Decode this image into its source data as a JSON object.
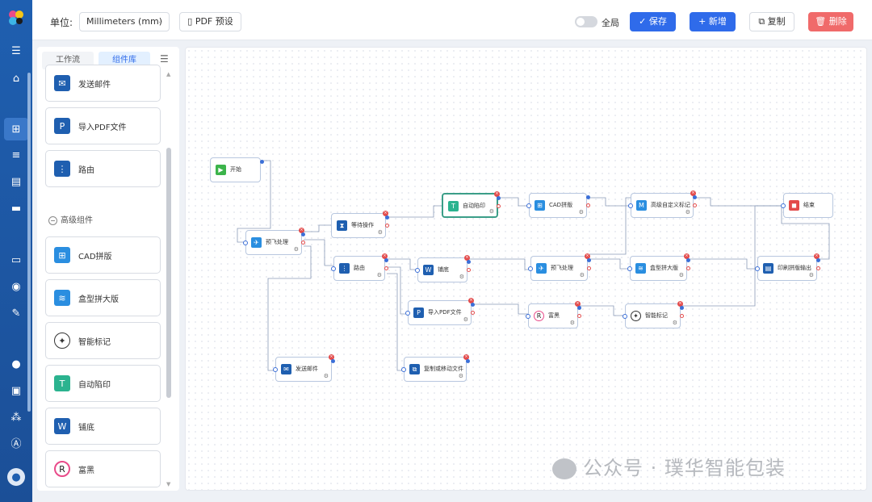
{
  "topbar": {
    "unit_label": "单位:",
    "unit_value": "Millimeters (mm)",
    "pdf_preset": "PDF 预设",
    "global_label": "全局",
    "save": "保存",
    "add": "新增",
    "copy": "复制",
    "delete": "删除"
  },
  "panel": {
    "tabs": [
      "工作流",
      "组件库"
    ],
    "section_advanced": "高级组件",
    "components": [
      {
        "label": "发送邮件",
        "icon": "mail-icon",
        "color": "#1f5fb0"
      },
      {
        "label": "导入PDF文件",
        "icon": "pdf-icon",
        "color": "#1f5fb0"
      },
      {
        "label": "路由",
        "icon": "router-icon",
        "color": "#1f5fb0"
      },
      {
        "label": "CAD拼版",
        "icon": "cad-icon",
        "color": "#2a8ee0"
      },
      {
        "label": "盒型拼大版",
        "icon": "box-layout-icon",
        "color": "#2a8ee0"
      },
      {
        "label": "智能标记",
        "icon": "smart-mark-icon",
        "color": "#333333"
      },
      {
        "label": "自动陷印",
        "icon": "trap-icon",
        "color": "#2bb38f"
      },
      {
        "label": "铺底",
        "icon": "underlay-icon",
        "color": "#1f5fb0"
      },
      {
        "label": "富黑",
        "icon": "rich-black-icon",
        "color": "#222222"
      }
    ]
  },
  "nodes": [
    {
      "id": "start",
      "label": "开始",
      "icon": "play-icon",
      "color": "#3cb44b"
    },
    {
      "id": "preflight1",
      "label": "预飞处理",
      "icon": "plane-icon",
      "color": "#2a8ee0"
    },
    {
      "id": "wait",
      "label": "等待操作",
      "icon": "hourglass-icon",
      "color": "#1f5fb0"
    },
    {
      "id": "autotrap",
      "label": "自动陷印",
      "icon": "trap-icon",
      "color": "#2bb38f"
    },
    {
      "id": "cad",
      "label": "CAD拼版",
      "icon": "cad-icon",
      "color": "#2a8ee0"
    },
    {
      "id": "custommark",
      "label": "高级自定义标记",
      "icon": "mark-icon",
      "color": "#2a8ee0"
    },
    {
      "id": "end",
      "label": "结束",
      "icon": "stop-icon",
      "color": "#e34b4b"
    },
    {
      "id": "route",
      "label": "路由",
      "icon": "router-icon",
      "color": "#1f5fb0"
    },
    {
      "id": "underlay",
      "label": "铺底",
      "icon": "underlay-icon",
      "color": "#1f5fb0"
    },
    {
      "id": "preflight2",
      "label": "预飞处理",
      "icon": "plane-icon",
      "color": "#2a8ee0"
    },
    {
      "id": "boxlayout",
      "label": "盒型拼大版",
      "icon": "box-layout-icon",
      "color": "#2a8ee0"
    },
    {
      "id": "printout",
      "label": "印刷拼版输出",
      "icon": "print-output-icon",
      "color": "#1f5fb0"
    },
    {
      "id": "importpdf",
      "label": "导入PDF文件",
      "icon": "pdf-icon",
      "color": "#1f5fb0"
    },
    {
      "id": "richblack",
      "label": "富黑",
      "icon": "rich-black-icon",
      "color": "#222222"
    },
    {
      "id": "smartmark",
      "label": "智能标记",
      "icon": "smart-mark-icon",
      "color": "#333333"
    },
    {
      "id": "sendmail",
      "label": "发送邮件",
      "icon": "mail-icon",
      "color": "#1f5fb0"
    },
    {
      "id": "copymove",
      "label": "复制或移动文件",
      "icon": "copy-file-icon",
      "color": "#1f5fb0"
    }
  ],
  "watermark": "公众号 · 璞华智能包装"
}
